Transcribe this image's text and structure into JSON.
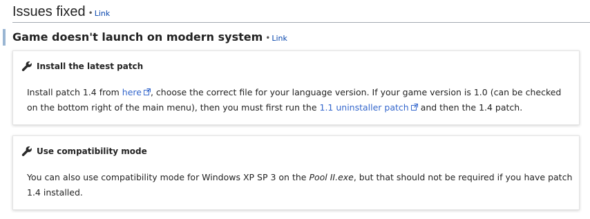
{
  "section": {
    "title": "Issues fixed",
    "separator": "•",
    "edit_link": "Link"
  },
  "subsection": {
    "title": "Game doesn't launch on modern system",
    "separator": "•",
    "edit_link": "Link"
  },
  "fixes": [
    {
      "icon": "wrench-icon",
      "title": "Install the latest patch",
      "text_1": "Install patch 1.4 from ",
      "link_1": "here",
      "text_2": ", choose the correct file for your language version. If your game version is 1.0 (can be checked on the bottom right of the main menu), then you must first run the ",
      "link_2": "1.1 uninstaller patch",
      "text_3": " and then the 1.4 patch."
    },
    {
      "icon": "wrench-icon",
      "title": "Use compatibility mode",
      "text_1": "You can also use compatibility mode for Windows XP SP 3 on the ",
      "emphasis": "Pool II.exe",
      "text_2": ", but that should not be required if you have patch 1.4 installed."
    }
  ],
  "colors": {
    "link": "#3366cc",
    "edit_link": "#0645ad",
    "subsection_bar": "#9ab6d3"
  }
}
